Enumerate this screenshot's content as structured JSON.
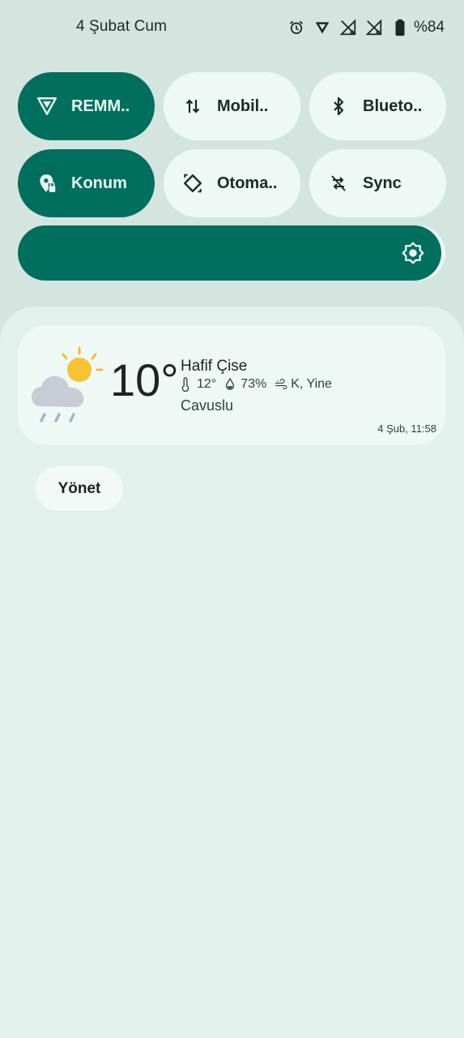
{
  "status_bar": {
    "date": "4 Şubat Cum",
    "battery": "%84",
    "icons": [
      "alarm-icon",
      "vpn-icon",
      "signal-off-icon",
      "signal-off-icon",
      "battery-icon"
    ]
  },
  "tiles": [
    {
      "label": "REMM..",
      "icon": "vpn-icon",
      "state": "on"
    },
    {
      "label": "Mobil..",
      "icon": "mobile-data-icon",
      "state": "off"
    },
    {
      "label": "Blueto..",
      "icon": "bluetooth-icon",
      "state": "off"
    },
    {
      "label": "Konum",
      "icon": "location-icon",
      "state": "on"
    },
    {
      "label": "Otoma..",
      "icon": "auto-rotate-icon",
      "state": "off"
    },
    {
      "label": "Sync",
      "icon": "sync-off-icon",
      "state": "off"
    }
  ],
  "brightness": {
    "level": 0.99,
    "icon": "brightness-icon"
  },
  "weather": {
    "temperature": "10°",
    "condition": "Hafif Çise",
    "feels_like": "12°",
    "humidity": "73%",
    "wind": "K, Yine",
    "location": "Cavuslu",
    "updated": "4 Şub, 11:58"
  },
  "manage_button": "Yönet",
  "colors": {
    "accent": "#016f5d",
    "background": "#d4e5e0",
    "panel": "#e3f1ed",
    "tile_off": "#eef8f4"
  }
}
